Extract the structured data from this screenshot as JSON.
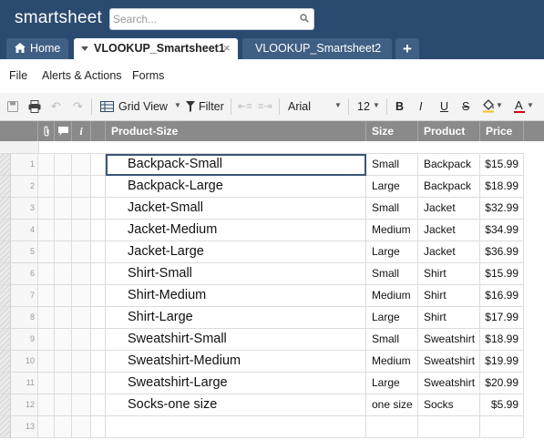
{
  "app": {
    "logo": "smartsheet",
    "search_placeholder": "Search..."
  },
  "tabs": {
    "home": "Home",
    "active": "VLOOKUP_Smartsheet1",
    "inactive": "VLOOKUP_Smartsheet2",
    "close_glyph": "×",
    "add_glyph": "+"
  },
  "menu": [
    "File",
    "Alerts & Actions",
    "Forms"
  ],
  "toolbar": {
    "view": "Grid View",
    "filter": "Filter",
    "font": "Arial",
    "font_size": "12",
    "bold": "B",
    "italic": "I",
    "underline": "U",
    "strike": "S",
    "text_color": "A",
    "text_color_bar": "#d0021b"
  },
  "columns": {
    "info": "i",
    "product_size": "Product-Size",
    "size": "Size",
    "product": "Product",
    "price": "Price"
  },
  "rows": [
    {
      "num": "1",
      "product_size": "Backpack-Small",
      "size": "Small",
      "product": "Backpack",
      "price": "$15.99"
    },
    {
      "num": "2",
      "product_size": "Backpack-Large",
      "size": "Large",
      "product": "Backpack",
      "price": "$18.99"
    },
    {
      "num": "3",
      "product_size": "Jacket-Small",
      "size": "Small",
      "product": "Jacket",
      "price": "$32.99"
    },
    {
      "num": "4",
      "product_size": "Jacket-Medium",
      "size": "Medium",
      "product": "Jacket",
      "price": "$34.99"
    },
    {
      "num": "5",
      "product_size": "Jacket-Large",
      "size": "Large",
      "product": "Jacket",
      "price": "$36.99"
    },
    {
      "num": "6",
      "product_size": "Shirt-Small",
      "size": "Small",
      "product": "Shirt",
      "price": "$15.99"
    },
    {
      "num": "7",
      "product_size": "Shirt-Medium",
      "size": "Medium",
      "product": "Shirt",
      "price": "$16.99"
    },
    {
      "num": "8",
      "product_size": "Shirt-Large",
      "size": "Large",
      "product": "Shirt",
      "price": "$17.99"
    },
    {
      "num": "9",
      "product_size": "Sweatshirt-Small",
      "size": "Small",
      "product": "Sweatshirt",
      "price": "$18.99"
    },
    {
      "num": "10",
      "product_size": "Sweatshirt-Medium",
      "size": "Medium",
      "product": "Sweatshirt",
      "price": "$19.99"
    },
    {
      "num": "11",
      "product_size": "Sweatshirt-Large",
      "size": "Large",
      "product": "Sweatshirt",
      "price": "$20.99"
    },
    {
      "num": "12",
      "product_size": "Socks-one size",
      "size": "one size",
      "product": "Socks",
      "price": "$5.99"
    },
    {
      "num": "13",
      "product_size": "",
      "size": "",
      "product": "",
      "price": ""
    }
  ],
  "selected_row": 0,
  "colors": {
    "topbar": "#2b4a6f",
    "header": "#8a8a8a",
    "selection": "#3b5475"
  }
}
